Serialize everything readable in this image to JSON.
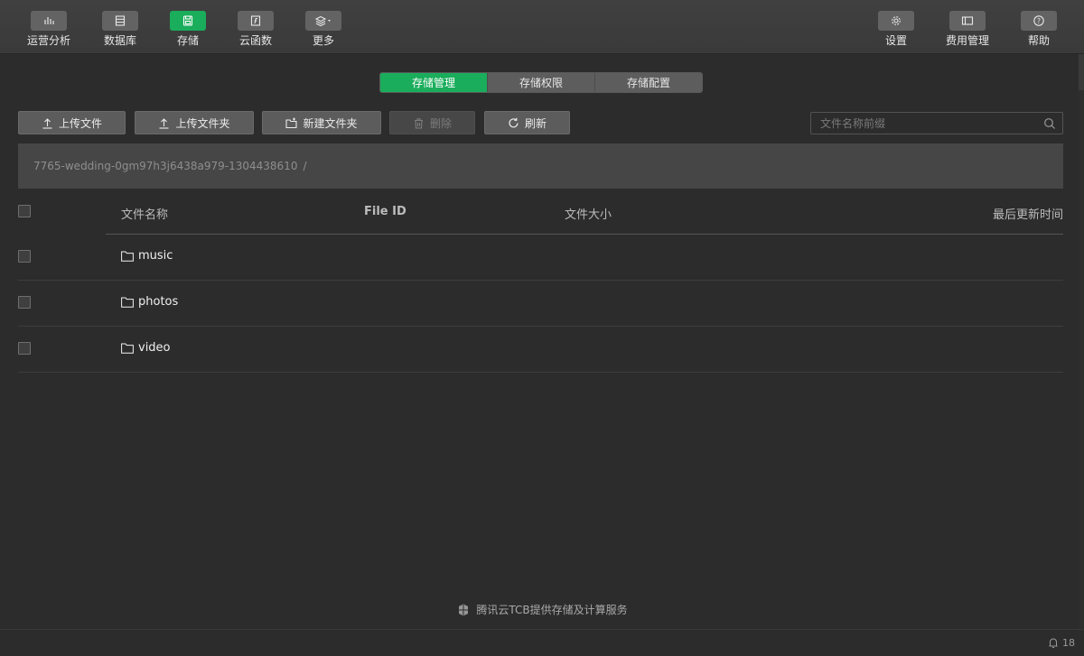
{
  "toolbar": {
    "left": [
      {
        "label": "运营分析",
        "icon": "chart-icon"
      },
      {
        "label": "数据库",
        "icon": "database-icon"
      },
      {
        "label": "存储",
        "icon": "storage-icon",
        "active": true
      },
      {
        "label": "云函数",
        "icon": "function-icon"
      },
      {
        "label": "更多",
        "icon": "layers-icon"
      }
    ],
    "right": [
      {
        "label": "设置",
        "icon": "gear-icon"
      },
      {
        "label": "费用管理",
        "icon": "billing-icon"
      },
      {
        "label": "帮助",
        "icon": "help-icon"
      }
    ]
  },
  "tabs": [
    "存储管理",
    "存储权限",
    "存储配置"
  ],
  "actions": {
    "upload_file": "上传文件",
    "upload_folder": "上传文件夹",
    "new_folder": "新建文件夹",
    "delete": "删除",
    "refresh": "刷新"
  },
  "search": {
    "placeholder": "文件名称前缀"
  },
  "path": {
    "bucket": "7765-wedding-0gm97h3j6438a979-1304438610",
    "separator": "/"
  },
  "table": {
    "columns": {
      "name": "文件名称",
      "file_id": "File ID",
      "size": "文件大小",
      "updated": "最后更新时间"
    },
    "rows": [
      {
        "name": "music",
        "type": "folder"
      },
      {
        "name": "photos",
        "type": "folder"
      },
      {
        "name": "video",
        "type": "folder"
      }
    ]
  },
  "footer": {
    "brand": "腾讯云TCB提供存储及计算服务"
  },
  "status": {
    "notification_count": "18"
  },
  "colors": {
    "accent": "#1aad5b",
    "background": "#2c2c2c",
    "toolbar": "#3c3c3c"
  }
}
